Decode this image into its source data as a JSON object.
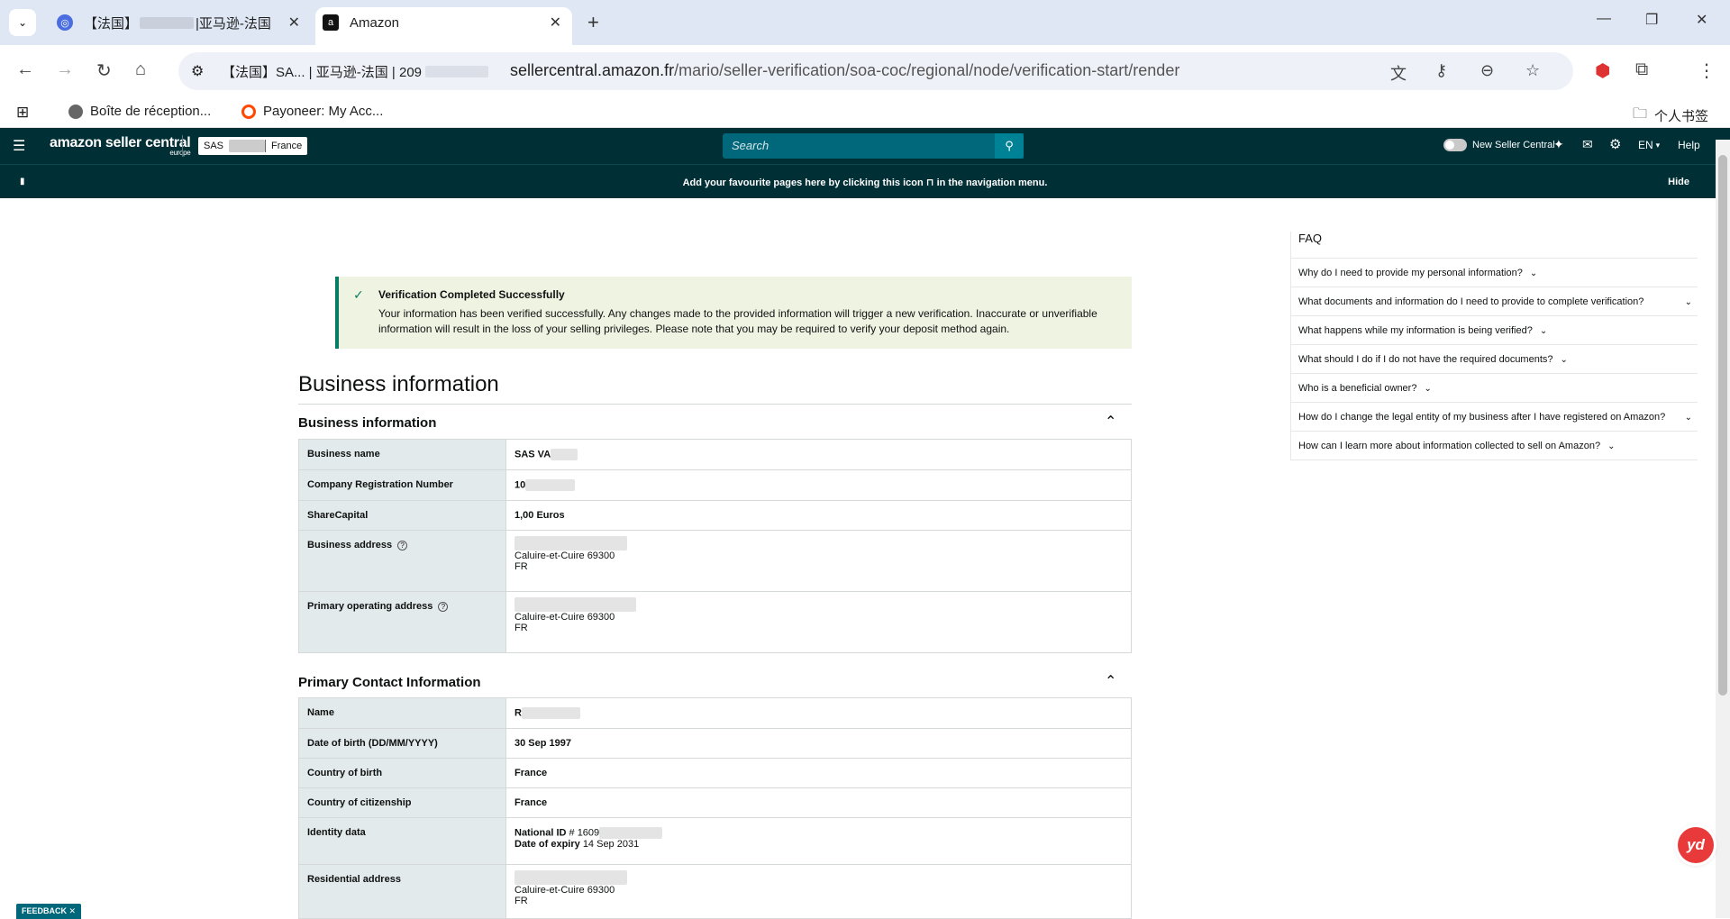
{
  "browser": {
    "tabs": [
      {
        "title": "【法国】",
        "title_suffix": "|亚马逊-法国",
        "active": false
      },
      {
        "title": "Amazon",
        "active": true
      }
    ],
    "new_tab_label": "+",
    "site_chip": "【法国】SA... | 亚马逊-法国 | 209",
    "url_host": "sellercentral.amazon.fr",
    "url_path": "/mario/seller-verification/soa-coc/regional/node/verification-start/render",
    "bookmarks": [
      {
        "label": "Boîte de réception...",
        "color": "#666666"
      },
      {
        "label": "Payoneer: My Acc...",
        "color": "#ff4800"
      }
    ],
    "bookmark_folder": "个人书签"
  },
  "seller_central": {
    "logo_text": "amazon seller central",
    "logo_sub": "europe",
    "account_name": "SAS",
    "marketplace": "France",
    "search_placeholder": "Search",
    "new_seller_central": "New Seller Central",
    "language": "EN",
    "help": "Help",
    "fav_message": "Add your favourite pages here by clicking this icon",
    "fav_message_tail": "in the navigation menu.",
    "hide": "Hide",
    "accent": "#002f36"
  },
  "banner": {
    "title": "Verification Completed Successfully",
    "text": "Your information has been verified successfully. Any changes made to the provided information will trigger a new verification. Inaccurate or unverifiable information will result in the loss of your selling privileges. Please note that you may be required to verify your deposit method again."
  },
  "page_title": "Business information",
  "business_section": {
    "heading": "Business information",
    "rows": {
      "name_label": "Business name",
      "name_value": "SAS VA",
      "crn_label": "Company Registration Number",
      "crn_value": "10",
      "capital_label": "ShareCapital",
      "capital_value": "1,00 Euros",
      "address_label": "Business address",
      "address_city": "Caluire-et-Cuire 69300",
      "address_country": "FR",
      "op_label": "Primary operating address",
      "op_city": "Caluire-et-Cuire 69300",
      "op_country": "FR"
    }
  },
  "contact_section": {
    "heading": "Primary Contact Information",
    "rows": {
      "name_label": "Name",
      "name_value": "R",
      "dob_label": "Date of birth (DD/MM/YYYY)",
      "dob_value": "30 Sep 1997",
      "cob_label": "Country of birth",
      "cob_value": "France",
      "coc_label": "Country of citizenship",
      "coc_value": "France",
      "id_label": "Identity data",
      "id_national_label": "National ID",
      "id_national_value": "# 1609",
      "id_expiry_label": "Date of expiry",
      "id_expiry_value": "14 Sep 2031",
      "res_label": "Residential address",
      "res_city": "Caluire-et-Cuire 69300",
      "res_country": "FR"
    }
  },
  "faq": {
    "title": "FAQ",
    "items": [
      "Why do I need to provide my personal information?",
      "What documents and information do I need to provide to complete verification?",
      "What happens while my information is being verified?",
      "What should I do if I do not have the required documents?",
      "Who is a beneficial owner?",
      "How do I change the legal entity of my business after I have registered on Amazon?",
      "How can I learn more about information collected to sell on Amazon?"
    ]
  },
  "feedback": "FEEDBACK ✕",
  "yd_badge": "yd"
}
